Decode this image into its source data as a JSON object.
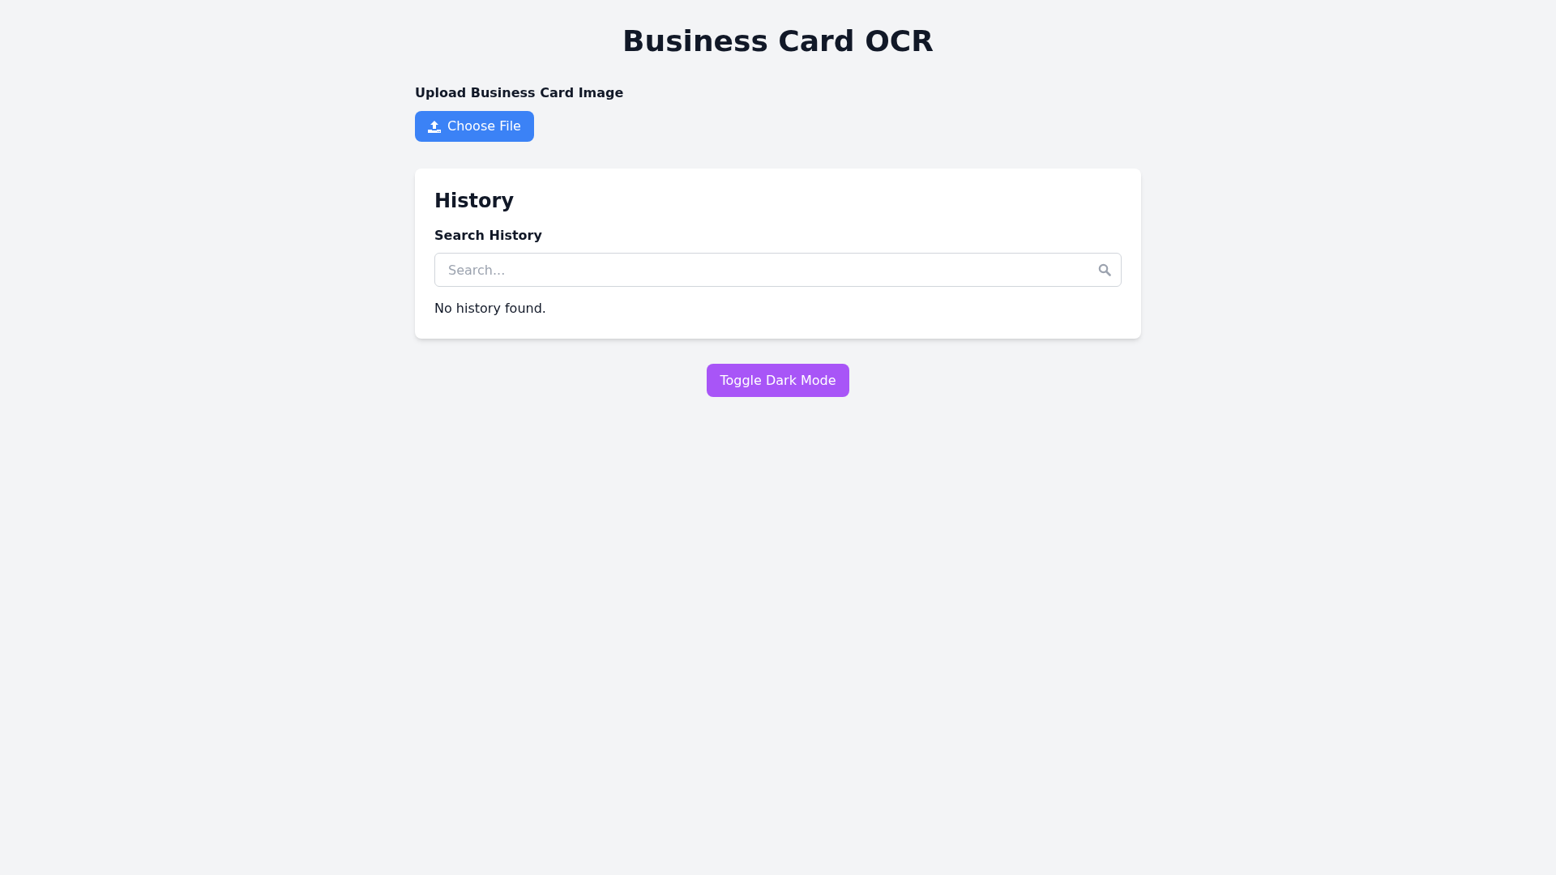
{
  "title": "Business Card OCR",
  "upload": {
    "label": "Upload Business Card Image",
    "button": "Choose File"
  },
  "history": {
    "title": "History",
    "search_label": "Search History",
    "search": {
      "placeholder": "Search..."
    },
    "empty_message": "No history found."
  },
  "dark_mode_button": "Toggle Dark Mode"
}
